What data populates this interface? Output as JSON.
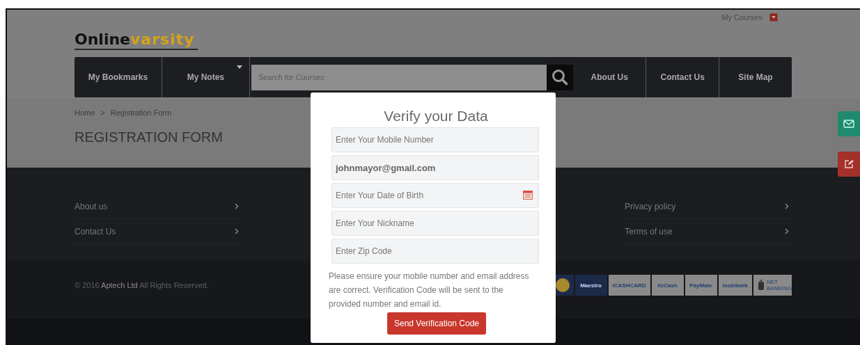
{
  "top_link": {
    "label": "My Courses"
  },
  "logo": {
    "part_1": "Online",
    "part_2": "varsity"
  },
  "nav": {
    "items": [
      {
        "label": "My Bookmarks",
        "dropdown": false
      },
      {
        "label": "My Notes",
        "dropdown": true
      }
    ],
    "search": {
      "placeholder": "Search for Courses"
    },
    "items_right": [
      {
        "label": "About Us"
      },
      {
        "label": "Contact Us"
      },
      {
        "label": "Site Map"
      }
    ]
  },
  "breadcrumb": {
    "items": [
      "Home",
      "Registration Form"
    ],
    "separator": ">"
  },
  "page_title": "REGISTRATION FORM",
  "footer": {
    "columns": [
      [
        {
          "label": "About us"
        },
        {
          "label": "Contact Us"
        }
      ],
      [
        {
          "label": "Privacy policy"
        },
        {
          "label": "Terms of use"
        }
      ]
    ],
    "copyright": {
      "prefix": "© 2016",
      "company": "Aptech Ltd",
      "suffix": "All Rights Reserved."
    },
    "payment_logos": [
      {
        "kind": "card"
      },
      {
        "kind": "maestro",
        "label": "Maestro"
      },
      {
        "kind": "text",
        "label": "iCASHCARD"
      },
      {
        "kind": "itz",
        "label": "itzCash"
      },
      {
        "kind": "text",
        "label": "PayMate"
      },
      {
        "kind": "text",
        "label": "mobikwik"
      },
      {
        "kind": "bank",
        "label": "NET BANKING"
      }
    ]
  },
  "side_buttons": [
    {
      "kind": "mail",
      "color": "#1f8a6e"
    },
    {
      "kind": "edit",
      "color": "#a3302a"
    }
  ],
  "modal": {
    "title": "Verify your Data",
    "fields": [
      {
        "kind": "text",
        "placeholder": "Enter Your Mobile Number"
      },
      {
        "kind": "text",
        "value": "johnmayor@gmail.com"
      },
      {
        "kind": "date",
        "placeholder": "Enter Your Date of Birth"
      },
      {
        "kind": "text",
        "placeholder": "Enter Your Nickname"
      },
      {
        "kind": "text",
        "placeholder": "Enter Zip Code"
      }
    ],
    "note": "Please ensure your mobile number and email address are correct. Verification Code will be sent to the provided number and email id.",
    "button": "Send Verification Code"
  }
}
